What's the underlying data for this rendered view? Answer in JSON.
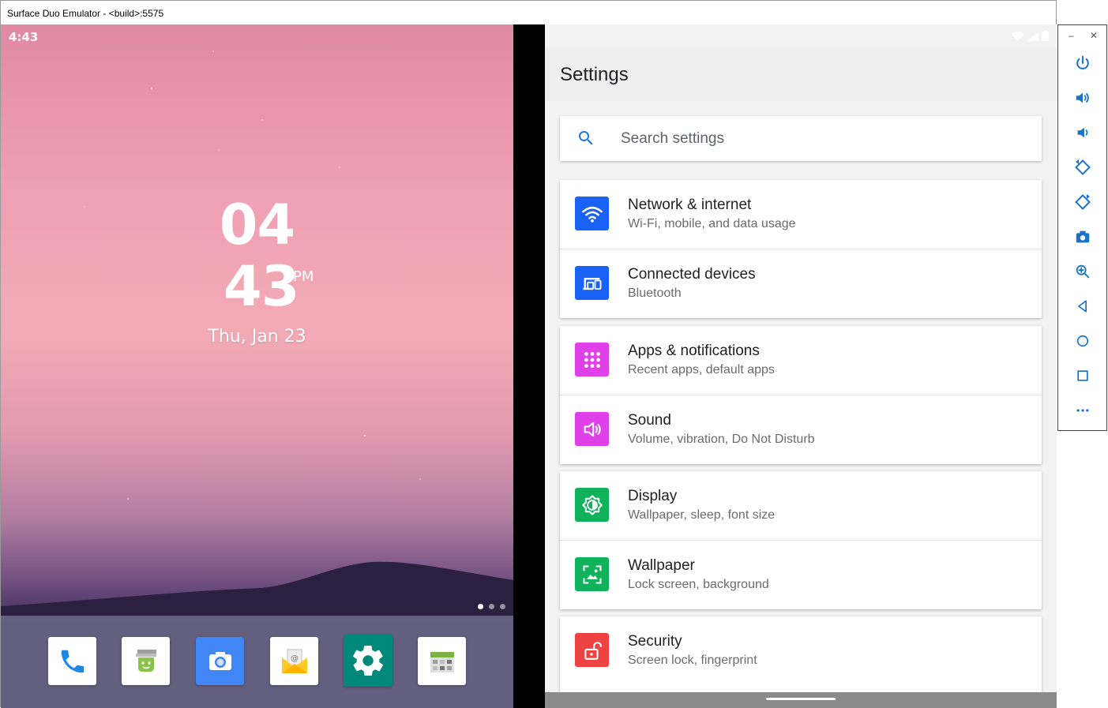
{
  "window": {
    "title": "Surface Duo Emulator - <build>:5575"
  },
  "left_screen": {
    "status_time": "4:43",
    "clock": {
      "hour": "04",
      "minute": "43",
      "ampm": "PM",
      "date": "Thu, Jan 23"
    },
    "page_dots": 3,
    "dock": [
      {
        "name": "phone",
        "icon": "phone-icon"
      },
      {
        "name": "messaging",
        "icon": "android-message-icon"
      },
      {
        "name": "camera",
        "icon": "camera-icon"
      },
      {
        "name": "email",
        "icon": "email-icon"
      },
      {
        "name": "settings",
        "icon": "gear-icon"
      },
      {
        "name": "calendar",
        "icon": "calendar-icon"
      }
    ]
  },
  "right_screen": {
    "toolbar_title": "Settings",
    "search_placeholder": "Search settings",
    "groups": [
      [
        {
          "title": "Network & internet",
          "subtitle": "Wi-Fi, mobile, and data usage",
          "icon": "wifi-icon",
          "color": "#1a62f5"
        },
        {
          "title": "Connected devices",
          "subtitle": "Bluetooth",
          "icon": "devices-icon",
          "color": "#1a62f5"
        }
      ],
      [
        {
          "title": "Apps & notifications",
          "subtitle": "Recent apps, default apps",
          "icon": "apps-grid-icon",
          "color": "#e040e8"
        },
        {
          "title": "Sound",
          "subtitle": "Volume, vibration, Do Not Disturb",
          "icon": "speaker-icon",
          "color": "#e040e8"
        }
      ],
      [
        {
          "title": "Display",
          "subtitle": "Wallpaper, sleep, font size",
          "icon": "brightness-icon",
          "color": "#0fb15b"
        },
        {
          "title": "Wallpaper",
          "subtitle": "Lock screen, background",
          "icon": "wallpaper-icon",
          "color": "#0fb15b"
        }
      ],
      [
        {
          "title": "Security",
          "subtitle": "Screen lock, fingerprint",
          "icon": "lock-open-icon",
          "color": "#ef4342"
        }
      ]
    ]
  },
  "side_panel": {
    "window_controls": [
      "minimize-icon",
      "close-icon"
    ],
    "buttons": [
      "power-icon",
      "volume-up-icon",
      "volume-down-icon",
      "rotate-left-icon",
      "rotate-right-icon",
      "camera-icon",
      "zoom-icon",
      "back-icon",
      "home-icon",
      "overview-icon",
      "more-icon"
    ]
  }
}
